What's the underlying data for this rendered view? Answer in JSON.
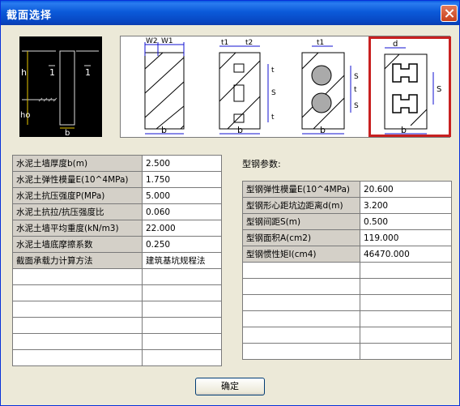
{
  "window": {
    "title": "截面选择"
  },
  "preview": {
    "labels": {
      "h": "h",
      "ho": "ho",
      "b": "b",
      "one": "1"
    }
  },
  "diagrams": [
    {
      "top_labels": [
        "W2",
        "W1"
      ],
      "bottom_label": "b",
      "side_labels": []
    },
    {
      "top_labels": [
        "t1",
        "t2"
      ],
      "bottom_label": "b",
      "side_labels": [
        "t",
        "S",
        "t"
      ]
    },
    {
      "top_labels": [
        "t1"
      ],
      "bottom_label": "b",
      "side_labels": [
        "S",
        "t",
        "S"
      ]
    },
    {
      "top_labels": [
        "d"
      ],
      "bottom_label": "b",
      "side_labels": [
        "S"
      ],
      "selected": true
    }
  ],
  "params": [
    {
      "label": "水泥土墙厚度b(m)",
      "value": "2.500"
    },
    {
      "label": "水泥土弹性模量E(10^4MPa)",
      "value": "1.750"
    },
    {
      "label": "水泥土抗压强度P(MPa)",
      "value": "5.000"
    },
    {
      "label": "水泥土抗拉/抗压强度比",
      "value": "0.060"
    },
    {
      "label": "水泥土墙平均重度(kN/m3)",
      "value": "22.000"
    },
    {
      "label": "水泥土墙底摩擦系数",
      "value": "0.250"
    },
    {
      "label": "截面承载力计算方法",
      "value": "建筑基坑规程法"
    }
  ],
  "steel_section_label": "型钢参数:",
  "steel_params": [
    {
      "label": "型钢弹性模量E(10^4MPa)",
      "value": "20.600"
    },
    {
      "label": "型钢形心距坑边距离d(m)",
      "value": "3.200"
    },
    {
      "label": "型钢间距S(m)",
      "value": "0.500"
    },
    {
      "label": "型钢面积A(cm2)",
      "value": "119.000"
    },
    {
      "label": "型钢惯性矩I(cm4)",
      "value": "46470.000"
    }
  ],
  "buttons": {
    "ok": "确定"
  }
}
